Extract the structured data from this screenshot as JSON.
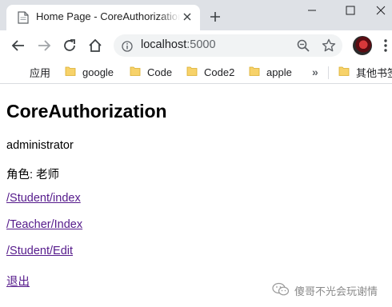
{
  "browser": {
    "tab": {
      "title": "Home Page - CoreAuthorization",
      "favicon": "document-icon"
    },
    "address_bar": {
      "host": "localhost",
      "port": ":5000"
    },
    "bookmarks": [
      {
        "label": "应用",
        "icon": "apps-grid-icon"
      },
      {
        "label": "google",
        "icon": "folder-icon"
      },
      {
        "label": "Code",
        "icon": "folder-icon"
      },
      {
        "label": "Code2",
        "icon": "folder-icon"
      },
      {
        "label": "apple",
        "icon": "folder-icon"
      },
      {
        "label": "其他书签",
        "icon": "folder-icon"
      }
    ],
    "bookmarks_overflow": "»"
  },
  "page": {
    "heading": "CoreAuthorization",
    "username": "administrator",
    "role_line": "角色: 老师",
    "links": [
      {
        "label": "/Student/index"
      },
      {
        "label": "/Teacher/Index"
      },
      {
        "label": "/Student/Edit"
      },
      {
        "label": "退出"
      }
    ]
  },
  "watermark": {
    "text": "傻哥不光会玩谢情"
  },
  "colors": {
    "tabstrip_bg": "#dee1e6",
    "omnibox_bg": "#f1f3f4",
    "link_visited": "#551a8b",
    "folder_yellow": "#f7d26a"
  }
}
